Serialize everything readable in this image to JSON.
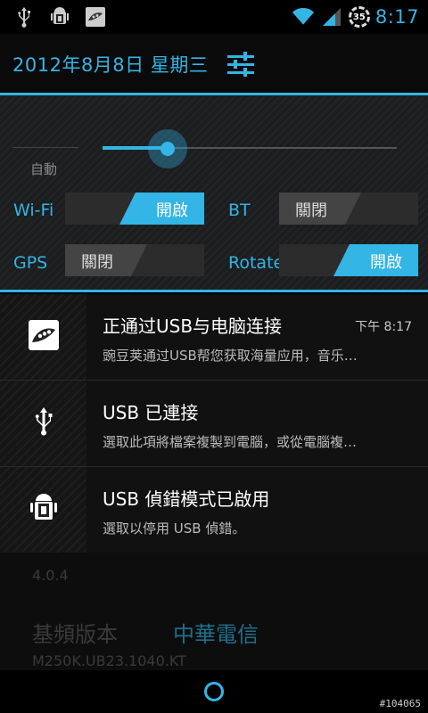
{
  "status_bar": {
    "icons_left": [
      "usb-icon",
      "android-debug-icon",
      "wandoujia-icon"
    ],
    "icons_right": [
      "wifi-icon",
      "signal-icon"
    ],
    "battery_level": "35",
    "time": "8:17"
  },
  "header": {
    "date": "2012年8月8日 星期三",
    "settings_icon": "settings-sliders-icon"
  },
  "quick_settings": {
    "brightness": {
      "auto_label": "自動",
      "level": 0.22
    },
    "toggles": [
      {
        "label": "Wi-Fi",
        "state": "開啟",
        "on": true
      },
      {
        "label": "BT",
        "state": "關閉",
        "on": false
      },
      {
        "label": "GPS",
        "state": "關閉",
        "on": false
      },
      {
        "label": "Rotate",
        "state": "開啟",
        "on": true
      }
    ]
  },
  "notifications": [
    {
      "icon": "wandoujia-icon",
      "title": "正通过USB与电脑连接",
      "time": "下午 8:17",
      "subtitle": "豌豆荚通过USB帮您获取海量应用，音乐…"
    },
    {
      "icon": "usb-icon",
      "title": "USB 已連接",
      "subtitle": "選取此項將檔案複製到電腦，或從電腦複…"
    },
    {
      "icon": "android-debug-icon",
      "title": "USB 偵錯模式已啟用",
      "subtitle": "選取以停用 USB 偵錯。"
    }
  ],
  "background": {
    "android_version": "4.0.4",
    "baseband_label": "基頻版本",
    "carrier": "中華電信",
    "baseband_value": "M250K.UB23.1040.KT"
  },
  "watermark": "#104065",
  "colors": {
    "accent": "#33b5e5",
    "background": "#000000"
  }
}
